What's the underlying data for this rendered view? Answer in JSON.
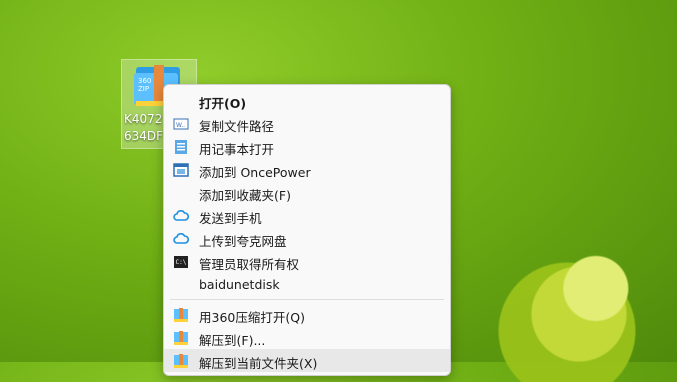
{
  "desktop": {
    "file_label_line1": "K4072",
    "file_label_line2": "634DF",
    "zip_badge_top": "360",
    "zip_badge_bottom": "ZIP"
  },
  "menu": {
    "items": [
      {
        "label": "打开(O)",
        "icon": "none"
      },
      {
        "label": "复制文件路径",
        "icon": "path-icon"
      },
      {
        "label": "用记事本打开",
        "icon": "notepad-icon"
      },
      {
        "label": "添加到 OncePower",
        "icon": "window-icon"
      },
      {
        "label": "添加到收藏夹(F)",
        "icon": "none"
      },
      {
        "label": "发送到手机",
        "icon": "cloud-icon"
      },
      {
        "label": "上传到夸克网盘",
        "icon": "cloud-icon"
      },
      {
        "label": "管理员取得所有权",
        "icon": "terminal-icon"
      },
      {
        "label": "baidunetdisk",
        "icon": "none"
      },
      {
        "label": "用360压缩打开(Q)",
        "icon": "zip-icon"
      },
      {
        "label": "解压到(F)...",
        "icon": "zip-icon"
      },
      {
        "label": "解压到当前文件夹(X)",
        "icon": "zip-icon"
      }
    ]
  },
  "colors": {
    "accent_blue": "#2f9de6",
    "zip_orange": "#e8883a",
    "menu_bg": "#f9f9f9"
  }
}
